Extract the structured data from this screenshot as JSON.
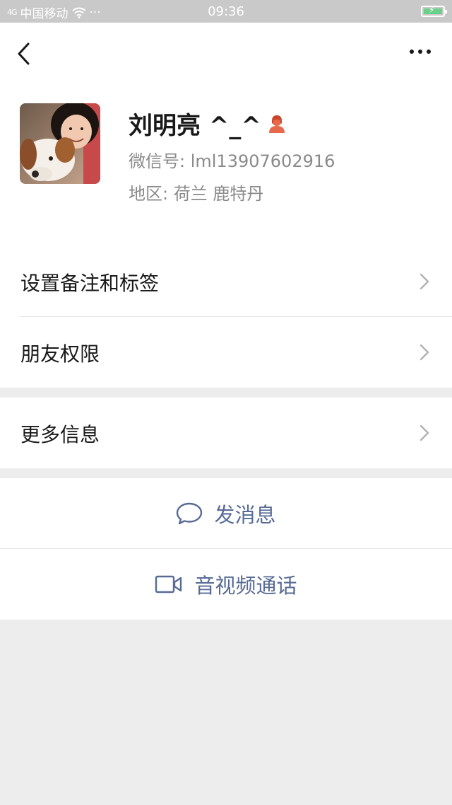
{
  "status_bar": {
    "signal_label": "4G",
    "carrier": "中国移动",
    "extra": "···",
    "time": "09:36"
  },
  "profile": {
    "name": "刘明亮 ^_^",
    "wechat_id": "微信号: lml13907602916",
    "region": "地区: 荷兰  鹿特丹",
    "gender_icon": "female-icon"
  },
  "menu": {
    "items": [
      {
        "label": "设置备注和标签"
      },
      {
        "label": "朋友权限"
      },
      {
        "label": "更多信息"
      }
    ]
  },
  "actions": {
    "send_message": "发消息",
    "video_call": "音视频通话"
  },
  "colors": {
    "link": "#576b95",
    "gender_icon": "#e5694a",
    "background": "#ededed",
    "status_bar": "#c9c9c9"
  }
}
